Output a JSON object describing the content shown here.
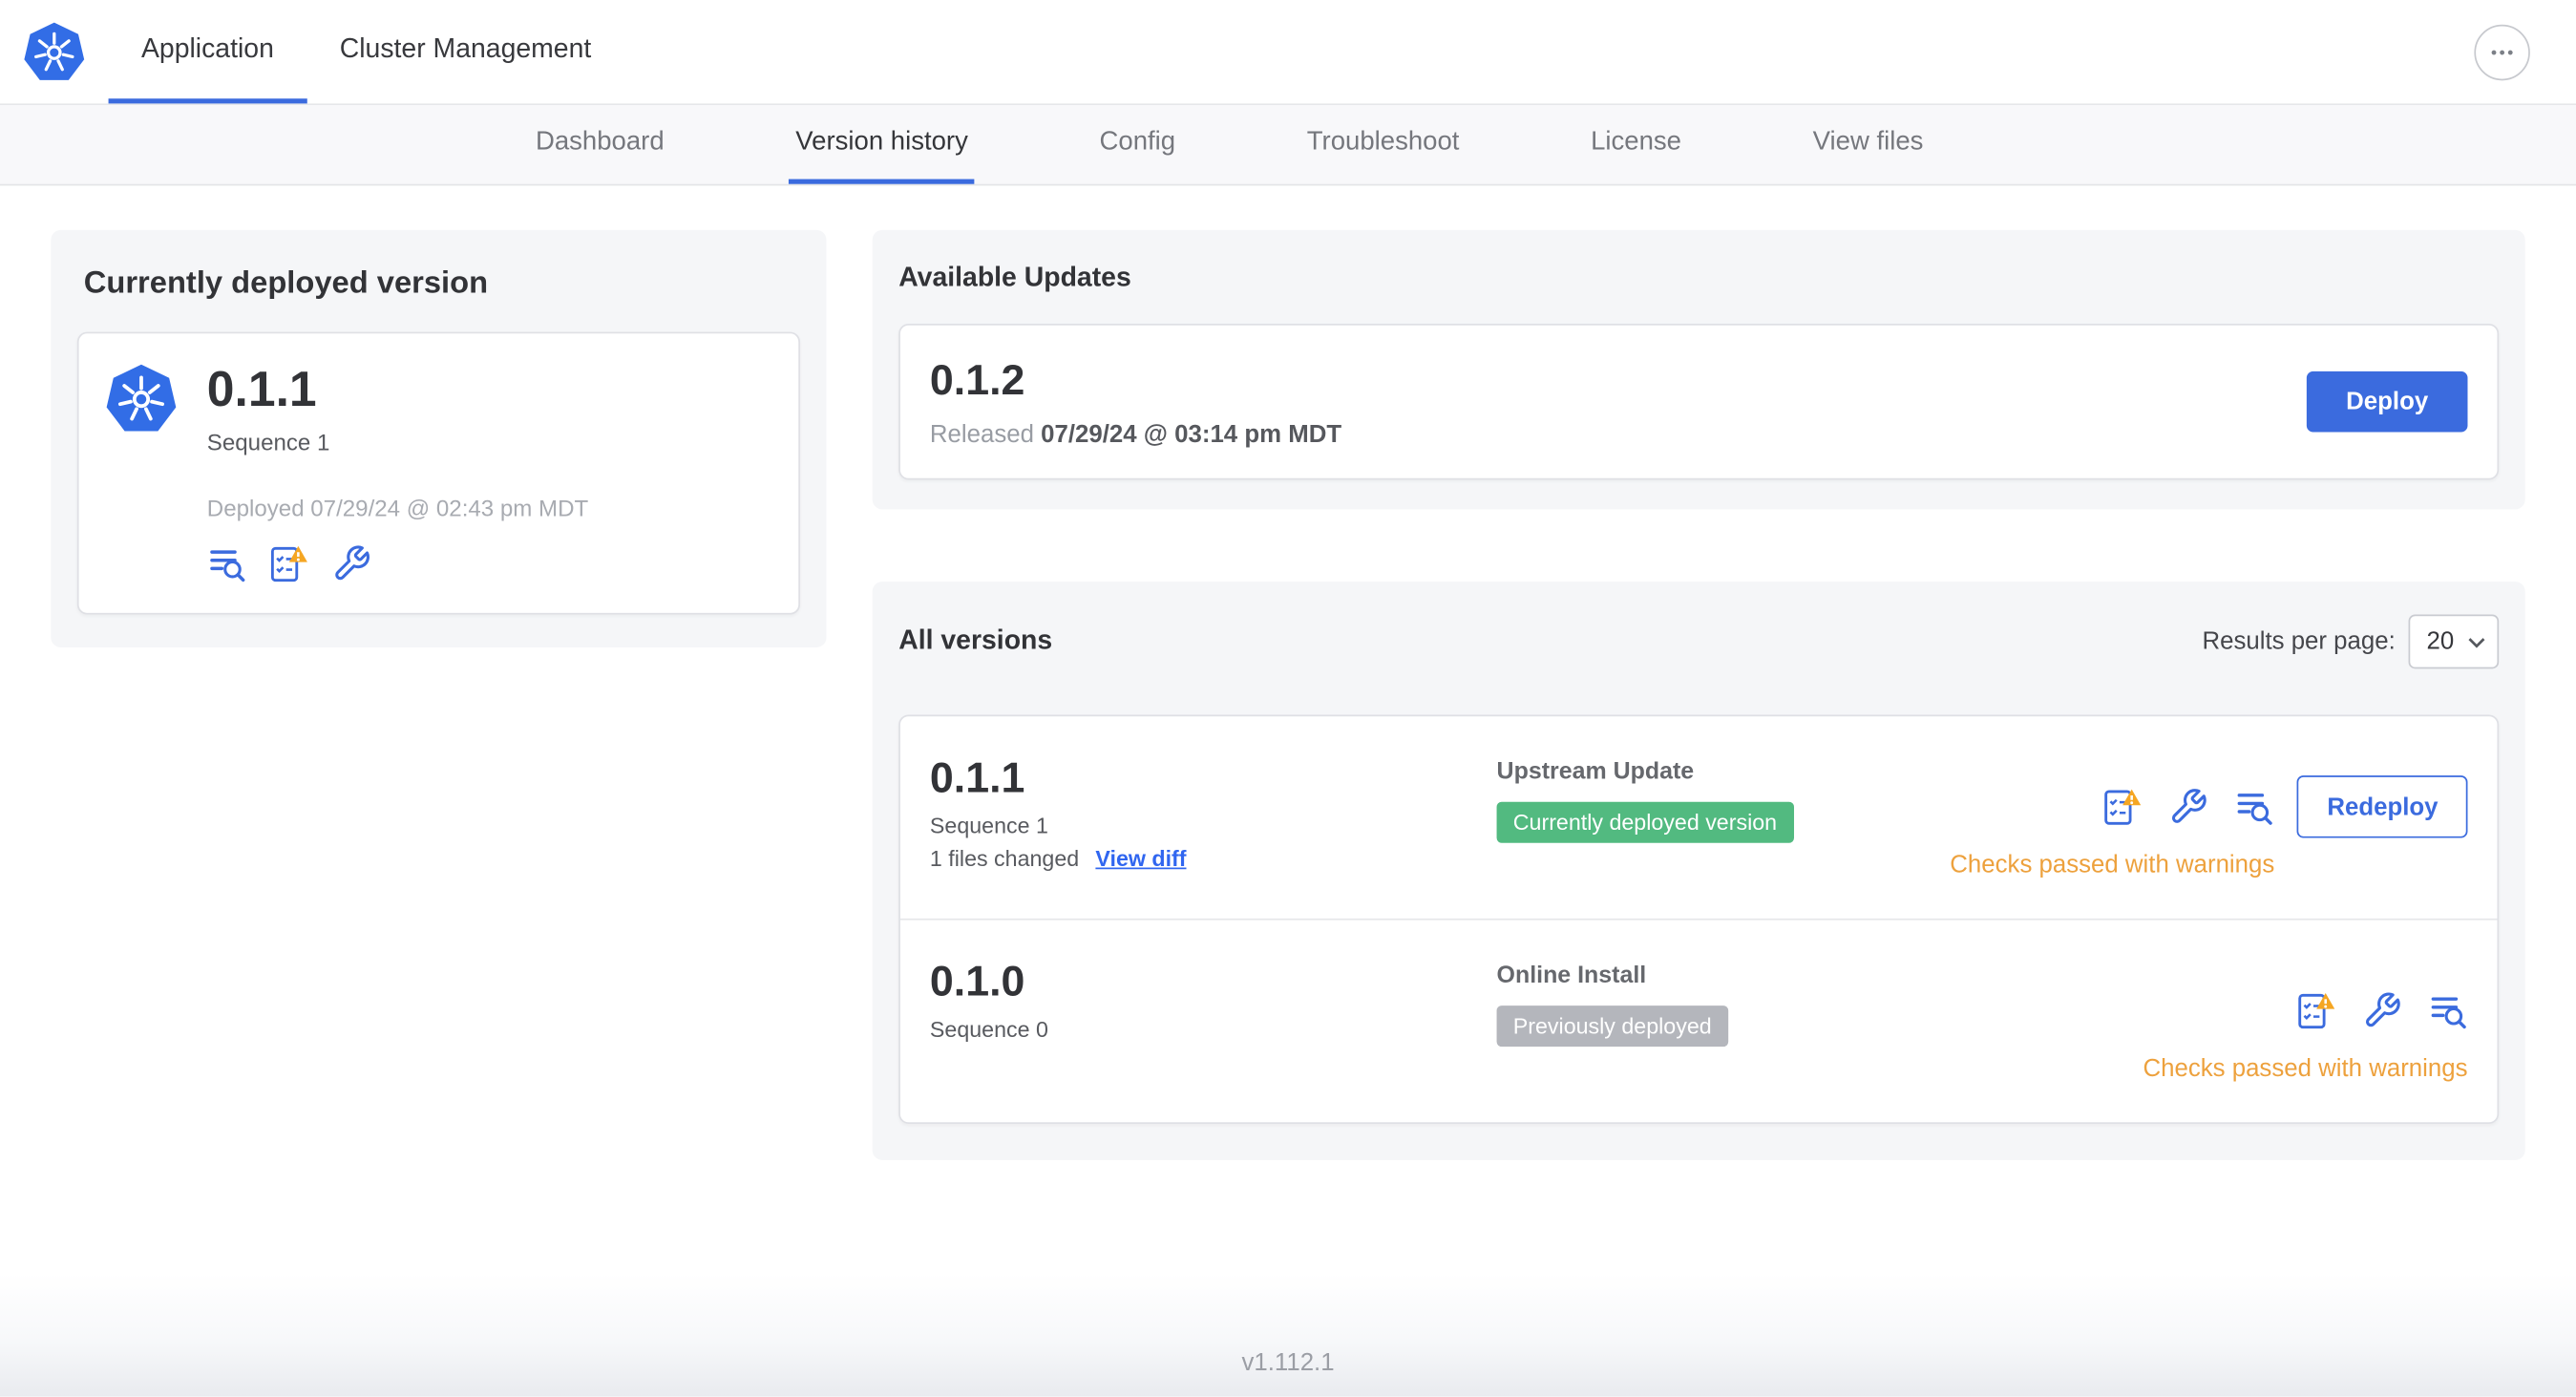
{
  "colors": {
    "primary_blue": "#3b6bde",
    "kubernetes_blue": "#326de6",
    "warning_orange": "#eda13d",
    "badge_green": "#52ba80",
    "badge_gray": "#b4b6bc"
  },
  "header": {
    "tabs": [
      {
        "label": "Application",
        "active": true
      },
      {
        "label": "Cluster Management",
        "active": false
      }
    ]
  },
  "subnav": {
    "items": [
      {
        "label": "Dashboard",
        "active": false
      },
      {
        "label": "Version history",
        "active": true
      },
      {
        "label": "Config",
        "active": false
      },
      {
        "label": "Troubleshoot",
        "active": false
      },
      {
        "label": "License",
        "active": false
      },
      {
        "label": "View files",
        "active": false
      }
    ]
  },
  "current_version": {
    "title": "Currently deployed version",
    "version": "0.1.1",
    "sequence": "Sequence 1",
    "deployed_text": "Deployed 07/29/24 @ 02:43 pm MDT"
  },
  "available_updates": {
    "title": "Available Updates",
    "version": "0.1.2",
    "released_prefix": "Released",
    "released_date": "07/29/24 @ 03:14 pm MDT",
    "deploy_label": "Deploy"
  },
  "all_versions": {
    "title": "All versions",
    "results_per_page_label": "Results per page:",
    "results_per_page_value": "20",
    "rows": [
      {
        "version": "0.1.1",
        "sequence": "Sequence 1",
        "files_changed": "1 files changed",
        "view_diff_label": "View diff",
        "source": "Upstream Update",
        "badge": "Currently deployed version",
        "status": "Checks passed with warnings",
        "action_label": "Redeploy"
      },
      {
        "version": "0.1.0",
        "sequence": "Sequence 0",
        "source": "Online Install",
        "badge": "Previously deployed",
        "status": "Checks passed with warnings"
      }
    ]
  },
  "footer": {
    "app_version": "v1.112.1"
  },
  "icons": {
    "app_logo": "kubernetes-logo",
    "more_menu": "ellipsis-icon",
    "diff": "diff-lines-magnifier-icon",
    "preflight": "checklist-warning-icon",
    "config": "wrench-icon",
    "select_chevron": "chevron-down-icon"
  }
}
